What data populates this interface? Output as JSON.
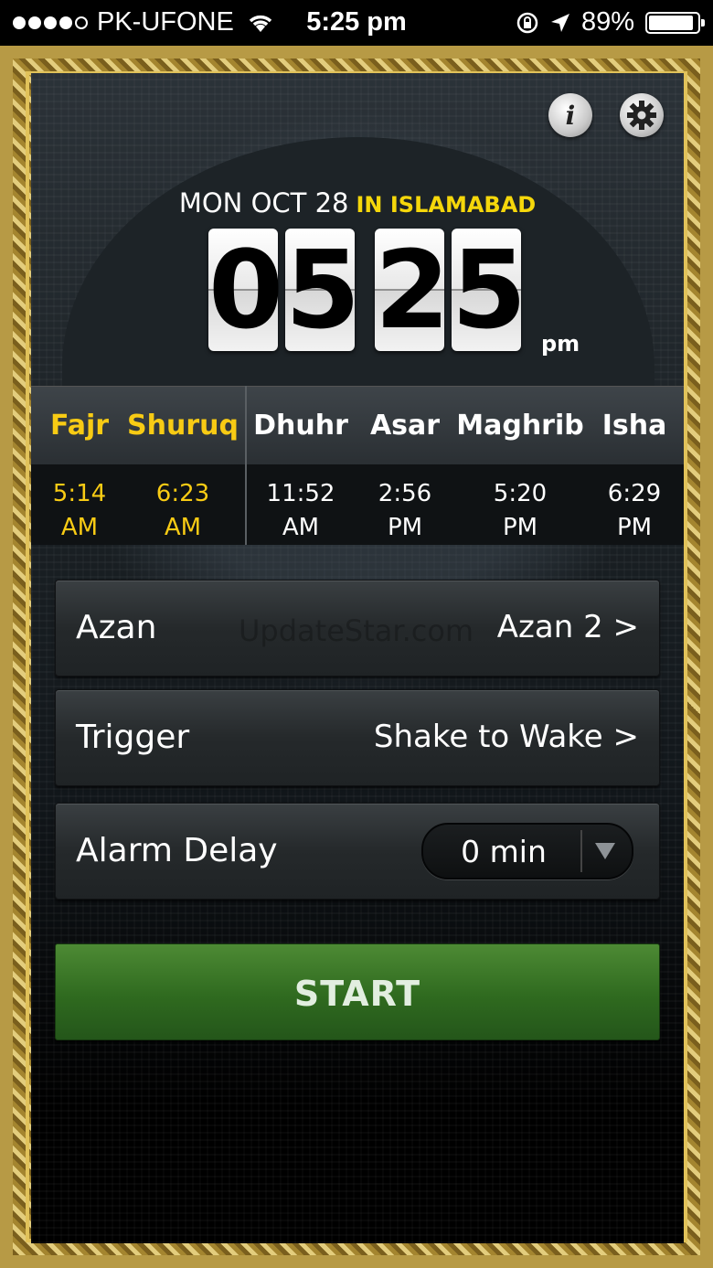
{
  "status_bar": {
    "carrier": "PK-UFONE",
    "time": "5:25 pm",
    "battery": "89%",
    "signal_bars_filled": 4,
    "signal_bars_total": 5
  },
  "header": {
    "info_icon": "i",
    "date": "MON OCT 28",
    "city": "IN ISLAMABAD",
    "clock_digits": [
      "0",
      "5",
      "2",
      "5"
    ],
    "meridiem": "pm"
  },
  "prayers": [
    {
      "name": "Fajr",
      "time": "5:14",
      "period": "AM",
      "highlight": true
    },
    {
      "name": "Shuruq",
      "time": "6:23",
      "period": "AM",
      "highlight": true
    },
    {
      "name": "Dhuhr",
      "time": "11:52",
      "period": "AM",
      "highlight": false
    },
    {
      "name": "Asar",
      "time": "2:56",
      "period": "PM",
      "highlight": false
    },
    {
      "name": "Maghrib",
      "time": "5:20",
      "period": "PM",
      "highlight": false
    },
    {
      "name": "Isha",
      "time": "6:29",
      "period": "PM",
      "highlight": false
    }
  ],
  "settings": {
    "azan": {
      "label": "Azan",
      "value": "Azan 2 >"
    },
    "trigger": {
      "label": "Trigger",
      "value": "Shake to Wake >"
    },
    "alarm_delay": {
      "label": "Alarm Delay",
      "value": "0 min"
    }
  },
  "watermark": "UpdateStar.com",
  "start_label": "START",
  "colors": {
    "highlight": "#f8cb14",
    "city": "#f5d70b",
    "start_button": "#2f6a1f",
    "frame": "#b79a45"
  }
}
